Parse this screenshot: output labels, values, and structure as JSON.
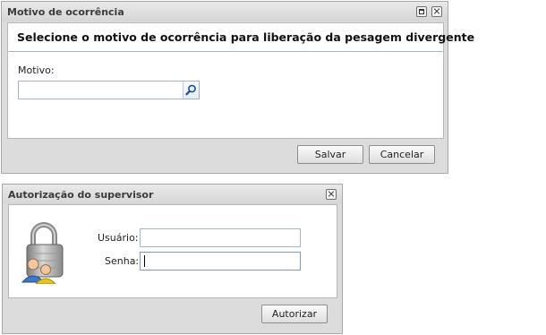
{
  "motivo_window": {
    "title": "Motivo de ocorrência",
    "heading": "Selecione o motivo de ocorrência para liberação da pesagem divergente",
    "field_label": "Motivo:",
    "field_value": "",
    "save_label": "Salvar",
    "cancel_label": "Cancelar"
  },
  "supervisor_window": {
    "title": "Autorização do supervisor",
    "user_label": "Usuário:",
    "user_value": "",
    "password_label": "Senha:",
    "password_value": "",
    "authorize_label": "Autorizar"
  },
  "icons": {
    "maximize": "maximize-icon",
    "close": "close-icon",
    "search": "search-icon",
    "padlock_users": "lock-users-icon"
  }
}
